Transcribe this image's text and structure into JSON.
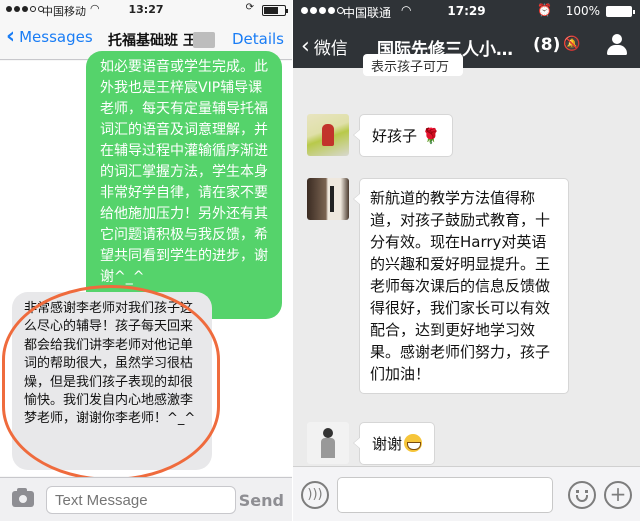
{
  "imessage": {
    "status": {
      "carrier": "中国移动",
      "time": "13:27"
    },
    "nav": {
      "back_label": "Messages",
      "title": "托福基础班 王",
      "details_label": "Details"
    },
    "messages": [
      {
        "side": "outgoing",
        "text": "如必要语音或学生完成。此外我也是王梓宸VIP辅导课老师，每天有定量辅导托福词汇的语音及词意理解，并在辅导过程中灌输循序渐进的词汇掌握方法，学生本身非常好学自律，请在家不要给他施加压力！另外还有其它问题请积极与我反馈，希望共同看到学生的进步，谢谢^_^"
      },
      {
        "side": "incoming",
        "text": "非常感谢李老师对我们孩子这么尽心的辅导！孩子每天回来都会给我们讲李老师对他记单词的帮助很大，虽然学习很枯燥，但是我们孩子表现的却很愉快。我们发自内心地感激李梦老师，谢谢你李老师！^_^"
      }
    ],
    "input": {
      "placeholder": "Text Message",
      "send_label": "Send"
    },
    "colors": {
      "accent": "#1a7df5",
      "outgoing_bubble": "#55d36b",
      "highlight_ring": "#ef6b3d"
    }
  },
  "wechat": {
    "status": {
      "carrier": "中国联通",
      "time": "17:29",
      "battery": "100%"
    },
    "nav": {
      "back_label": "微信",
      "title": "国际先修三人小…",
      "member_count": "(8)"
    },
    "messages": [
      {
        "text": "表示孩子可万重"
      },
      {
        "text": "好孩子",
        "emoji": "rose-icon"
      },
      {
        "text": "新航道的教学方法值得称道，对孩子鼓励式教育，十分有效。现在Harry对英语的兴趣和爱好明显提升。王老师每次课后的信息反馈做得很好，我们家长可以有效配合，达到更好地学习效果。感谢老师们努力，孩子们加油！"
      },
      {
        "text": "谢谢",
        "emoji": "grin-icon"
      }
    ],
    "colors": {
      "header": "#2f3337",
      "chat_bg": "#ebebeb"
    }
  }
}
